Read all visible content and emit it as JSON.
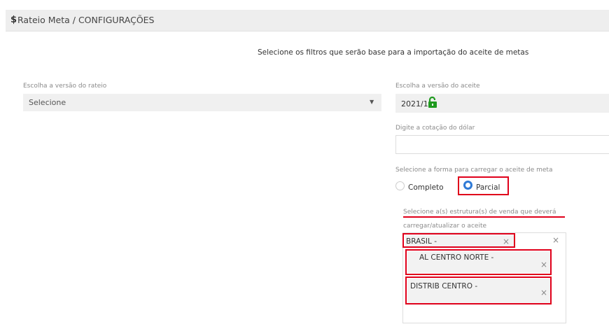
{
  "header": {
    "icon": "dollar-icon",
    "dollar_symbol": "$",
    "title": "Rateio Meta / CONFIGURAÇÕES"
  },
  "subtitle": "Selecione os filtros que serão base para a importação do aceite de metas",
  "rateio": {
    "label": "Escolha a versão do rateio",
    "value": "Selecione",
    "caret": "▼"
  },
  "aceite": {
    "label": "Escolha a versão do aceite",
    "value": "2021/1",
    "lock_icon": "lock-open-icon",
    "lock_color": "#1f9a1f"
  },
  "dolar": {
    "label": "Digite a cotação do dólar",
    "value": ""
  },
  "forma": {
    "label": "Selecione a forma para carregar o aceite de meta",
    "options": [
      {
        "label": "Completo",
        "selected": false
      },
      {
        "label": "Parcial",
        "selected": true
      }
    ]
  },
  "estrutura": {
    "label_line1": "Selecione a(s) estrutura(s) de venda que deverá",
    "label_line2": "carregar/atualizar o aceite",
    "clear_all": "×",
    "chips": [
      {
        "label": "BRASIL -",
        "remove": "×"
      },
      {
        "label": "AL CENTRO NORTE -",
        "remove": "×"
      },
      {
        "label": "DISTRIB CENTRO -",
        "remove": "×"
      }
    ]
  },
  "colors": {
    "highlight": "#e0001b",
    "radio_active": "#2f7ad6",
    "field_bg": "#f0f0f0"
  }
}
